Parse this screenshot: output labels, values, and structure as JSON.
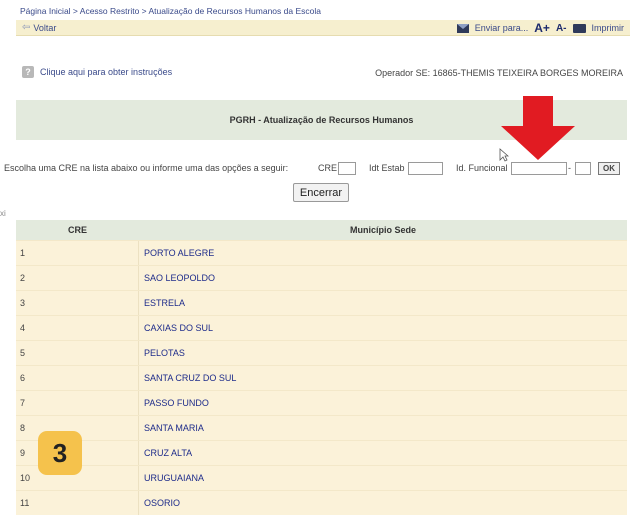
{
  "breadcrumb": "Página Inicial > Acesso Restrito > Atualização de Recursos Humanos da Escola",
  "topbar": {
    "back_label": "Voltar",
    "send_label": "Enviar para...",
    "font_increase": "A+",
    "font_decrease": "A-",
    "print_label": "Imprimir"
  },
  "instructions_link": "Clique aqui para obter instruções",
  "operator": "Operador SE: 16865-THEMIS TEIXEIRA BORGES MOREIRA",
  "panel_title": "PGRH - Atualização de Recursos Humanos",
  "form": {
    "prompt": "Escolha uma CRE na lista abaixo ou informe uma das opções a seguir:",
    "cre_label": "CRE",
    "idt_estab_label": "Idt Estab",
    "id_funcional_label": "Id. Funcional",
    "separator": "-",
    "ok_label": "OK",
    "cre_value": "",
    "idt_estab_value": "",
    "id_funcional_value": "",
    "id_funcional_digit_value": ""
  },
  "encerrar_label": "Encerrar",
  "left_edge_fragment": "xi",
  "table": {
    "headers": [
      "CRE",
      "Município Sede"
    ],
    "rows": [
      {
        "cre": "1",
        "municipio": "PORTO ALEGRE"
      },
      {
        "cre": "2",
        "municipio": "SAO LEOPOLDO"
      },
      {
        "cre": "3",
        "municipio": "ESTRELA"
      },
      {
        "cre": "4",
        "municipio": "CAXIAS DO SUL"
      },
      {
        "cre": "5",
        "municipio": "PELOTAS"
      },
      {
        "cre": "6",
        "municipio": "SANTA CRUZ DO SUL"
      },
      {
        "cre": "7",
        "municipio": "PASSO FUNDO"
      },
      {
        "cre": "8",
        "municipio": "SANTA MARIA"
      },
      {
        "cre": "9",
        "municipio": "CRUZ ALTA"
      },
      {
        "cre": "10",
        "municipio": "URUGUAIANA"
      },
      {
        "cre": "11",
        "municipio": "OSORIO"
      }
    ]
  },
  "step_badge": "3",
  "colors": {
    "highlight_arrow": "#e11b22",
    "badge": "#f5c24c",
    "panel": "#e3eadd",
    "row": "#fbf2d9"
  }
}
